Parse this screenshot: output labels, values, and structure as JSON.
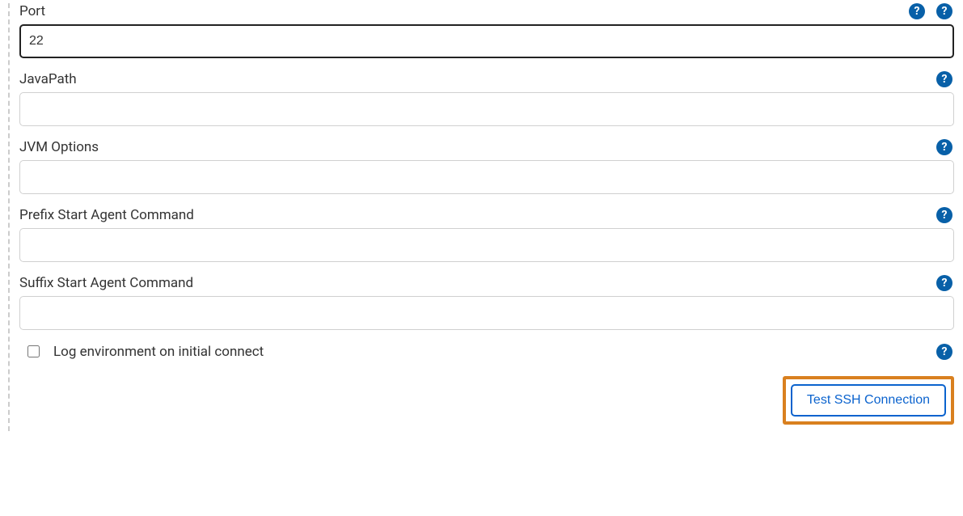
{
  "fields": {
    "port": {
      "label": "Port",
      "value": "22"
    },
    "javapath": {
      "label": "JavaPath",
      "value": ""
    },
    "jvmoptions": {
      "label": "JVM Options",
      "value": ""
    },
    "prefix": {
      "label": "Prefix Start Agent Command",
      "value": ""
    },
    "suffix": {
      "label": "Suffix Start Agent Command",
      "value": ""
    }
  },
  "checkbox": {
    "label": "Log environment on initial connect",
    "checked": false
  },
  "buttons": {
    "test_ssh": "Test SSH Connection"
  },
  "help_glyph": "?"
}
